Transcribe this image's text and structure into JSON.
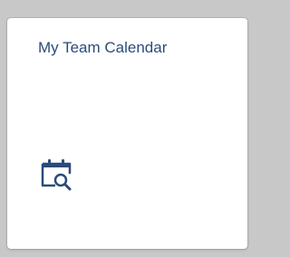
{
  "tile": {
    "title": "My Team Calendar",
    "icon": "calendar-search-icon",
    "accent_color": "#2b4b7a",
    "background_color": "#ffffff"
  }
}
